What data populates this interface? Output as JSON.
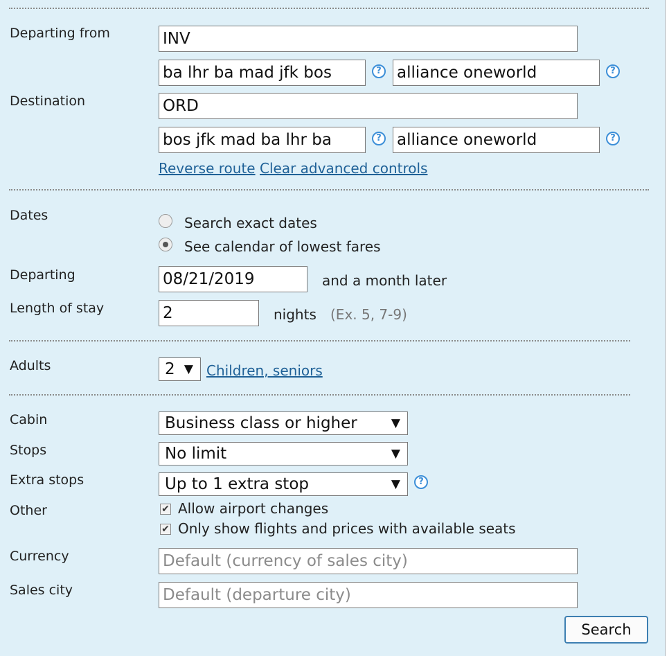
{
  "route": {
    "departing_label": "Departing from",
    "departing_value": "INV",
    "departing_routing": "ba lhr ba mad jfk bos",
    "departing_extension": "alliance oneworld",
    "destination_label": "Destination",
    "destination_value": "ORD",
    "return_routing": "bos jfk mad ba lhr ba",
    "return_extension": "alliance oneworld",
    "reverse_link": "Reverse route",
    "clear_link": "Clear advanced controls"
  },
  "dates": {
    "label": "Dates",
    "option_exact": "Search exact dates",
    "option_calendar": "See calendar of lowest fares",
    "selected": "See calendar of lowest fares",
    "departing_label": "Departing",
    "departing_value": "08/21/2019",
    "departing_suffix": "and a month later",
    "stay_label": "Length of stay",
    "stay_value": "2",
    "stay_unit": "nights",
    "stay_hint": "(Ex. 5, 7-9)"
  },
  "passengers": {
    "adults_label": "Adults",
    "adults_value": "2",
    "children_link": "Children, seniors"
  },
  "options": {
    "cabin_label": "Cabin",
    "cabin_value": "Business class or higher",
    "stops_label": "Stops",
    "stops_value": "No limit",
    "extra_label": "Extra stops",
    "extra_value": "Up to 1 extra stop",
    "other_label": "Other",
    "allow_airport_changes": "Allow airport changes",
    "only_available": "Only show flights and prices with available seats",
    "currency_label": "Currency",
    "currency_placeholder": "Default (currency of sales city)",
    "sales_label": "Sales city",
    "sales_placeholder": "Default (departure city)"
  },
  "help_glyph": "?",
  "dropdown_glyph": "▼",
  "check_glyph": "✔",
  "search_label": "Search"
}
